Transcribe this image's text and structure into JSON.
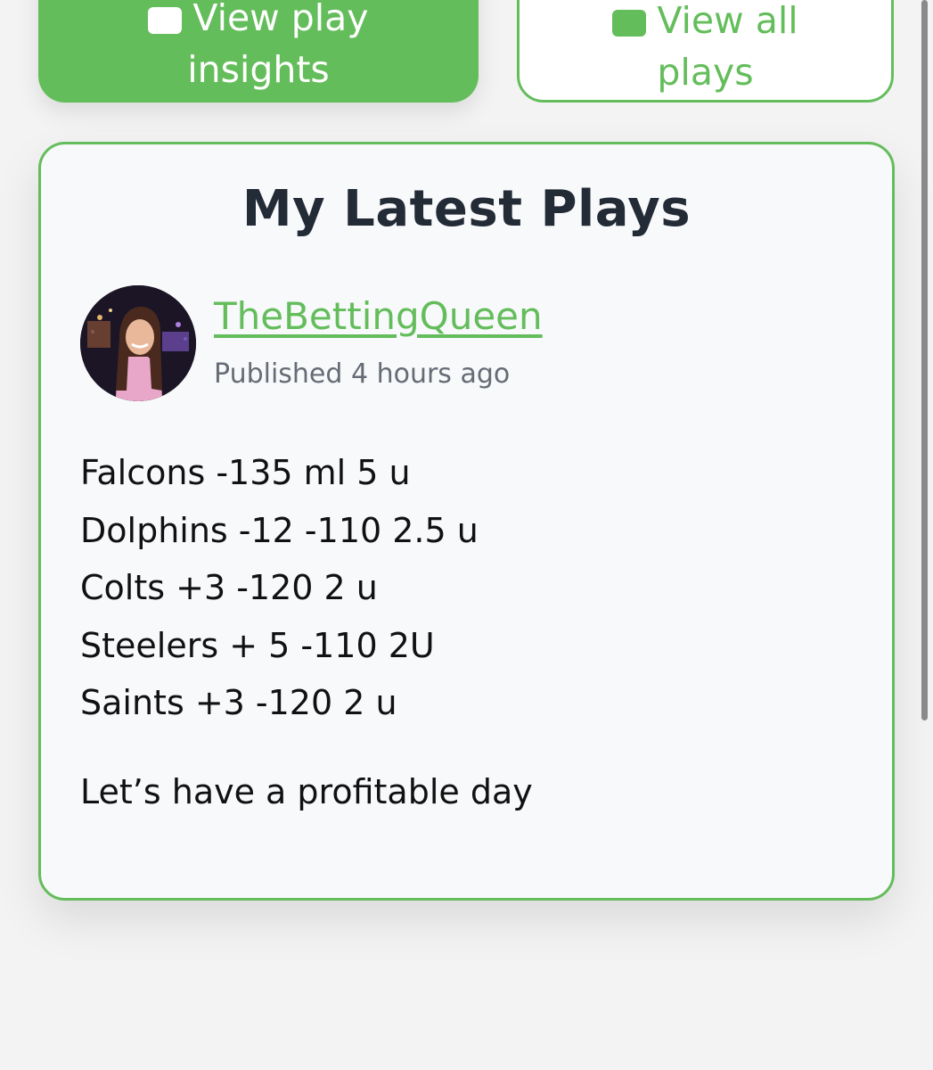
{
  "buttons": {
    "insights": {
      "line1": "View play",
      "line2": "insights"
    },
    "all_plays": {
      "line1": "View all",
      "line2": "plays"
    }
  },
  "card": {
    "title": "My Latest Plays",
    "author": "TheBettingQueen",
    "published": "Published 4 hours ago",
    "plays": [
      "Falcons -135 ml 5 u",
      "Dolphins -12 -110 2.5 u",
      "Colts +3 -120 2 u",
      "Steelers + 5 -110 2U",
      "Saints +3 -120 2 u"
    ],
    "closing": "Let’s have a profitable day"
  },
  "colors": {
    "accent": "#64bd5b",
    "title": "#232b36",
    "text": "#111111",
    "muted": "#666c75"
  }
}
